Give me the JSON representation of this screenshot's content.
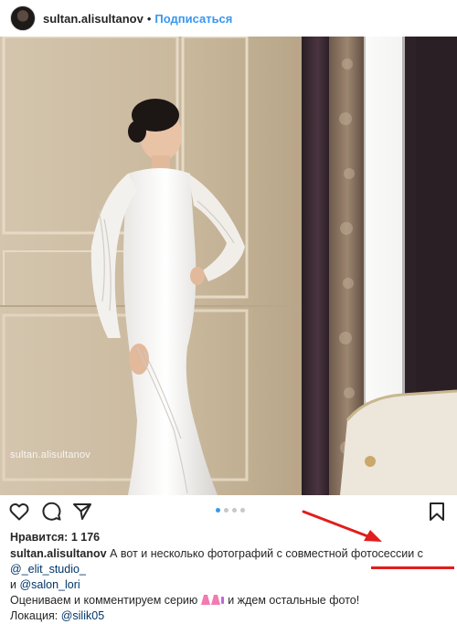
{
  "header": {
    "username": "sultan.alisultanov",
    "separator": "•",
    "follow_label": "Подписаться"
  },
  "photo": {
    "watermark": "sultan.alisultanov",
    "carousel": {
      "count": 4,
      "active_index": 0
    }
  },
  "post": {
    "likes": "Нравится: 1 176",
    "caption_user": "sultan.alisultanov",
    "caption_text_1": "А вот и несколько фотографий с совместной фотосессии с",
    "mention_1": "@_elit_studio_",
    "conjunction": "и",
    "mention_2": "@salon_lori",
    "line3_before": "Оцениваем и комментируем серию",
    "line3_after": "и ждем остальные фото!",
    "location_label": "Локация:",
    "location_mention": "@silik05"
  },
  "icons": {
    "like": "heart-icon",
    "comment": "comment-icon",
    "share": "share-icon",
    "save": "bookmark-icon",
    "emoji": "dress-emoji-icon"
  },
  "colors": {
    "link_blue": "#3897f0",
    "mention": "#003569",
    "annotation_red": "#e11d1d"
  }
}
